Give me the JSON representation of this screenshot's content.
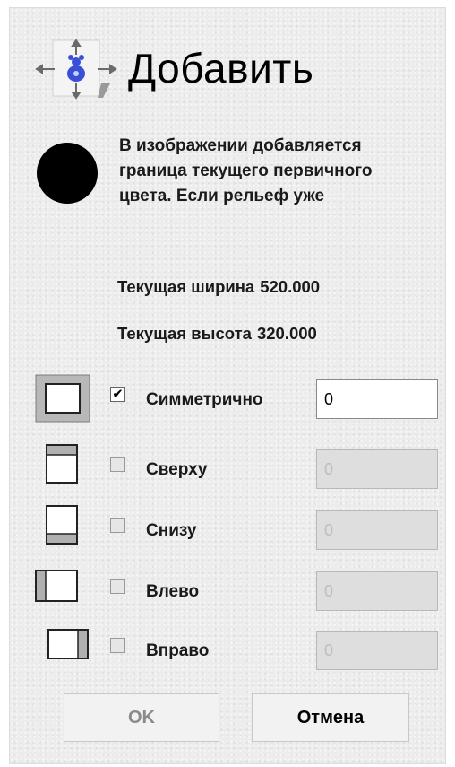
{
  "dialog": {
    "title": "Добавить",
    "icon": "add-border-icon",
    "color_swatch": "#000000",
    "description": "В изображении добавляется граница текущего первичного цвета. Если рельеф уже"
  },
  "info": {
    "width_label": "Текущая ширина",
    "width_value": "520.000",
    "height_label": "Текущая высота",
    "height_value": "320.000"
  },
  "options": [
    {
      "label": "Симметрично",
      "checked": true,
      "value": "0",
      "icon": "border-all-icon"
    },
    {
      "label": "Сверху",
      "checked": false,
      "value": "0",
      "icon": "border-top-icon"
    },
    {
      "label": "Снизу",
      "checked": false,
      "value": "0",
      "icon": "border-bottom-icon"
    },
    {
      "label": "Влево",
      "checked": false,
      "value": "0",
      "icon": "border-left-icon"
    },
    {
      "label": "Вправо",
      "checked": false,
      "value": "0",
      "icon": "border-right-icon"
    }
  ],
  "buttons": {
    "ok": "OK",
    "cancel": "Отмена"
  }
}
